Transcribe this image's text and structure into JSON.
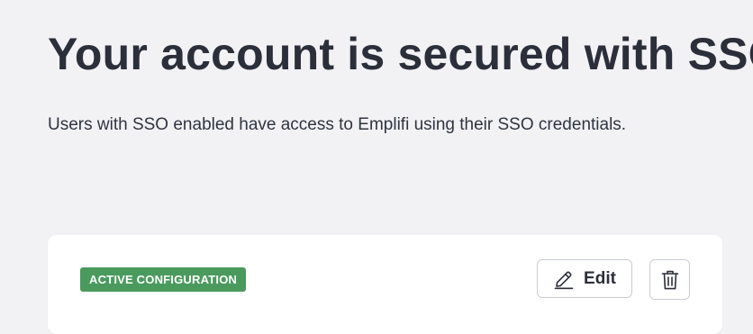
{
  "header": {
    "title": "Your account is secured with SSO",
    "description": "Users with SSO enabled have access to Emplifi using their SSO credentials."
  },
  "card": {
    "badge_label": "ACTIVE CONFIGURATION",
    "edit_label": "Edit",
    "edit_icon": "pencil-icon",
    "delete_icon": "trash-icon"
  },
  "colors": {
    "background": "#f2f2f5",
    "card": "#ffffff",
    "badge": "#4a9a5e",
    "text": "#2b2f3a",
    "button_border": "#c9ccd4"
  }
}
